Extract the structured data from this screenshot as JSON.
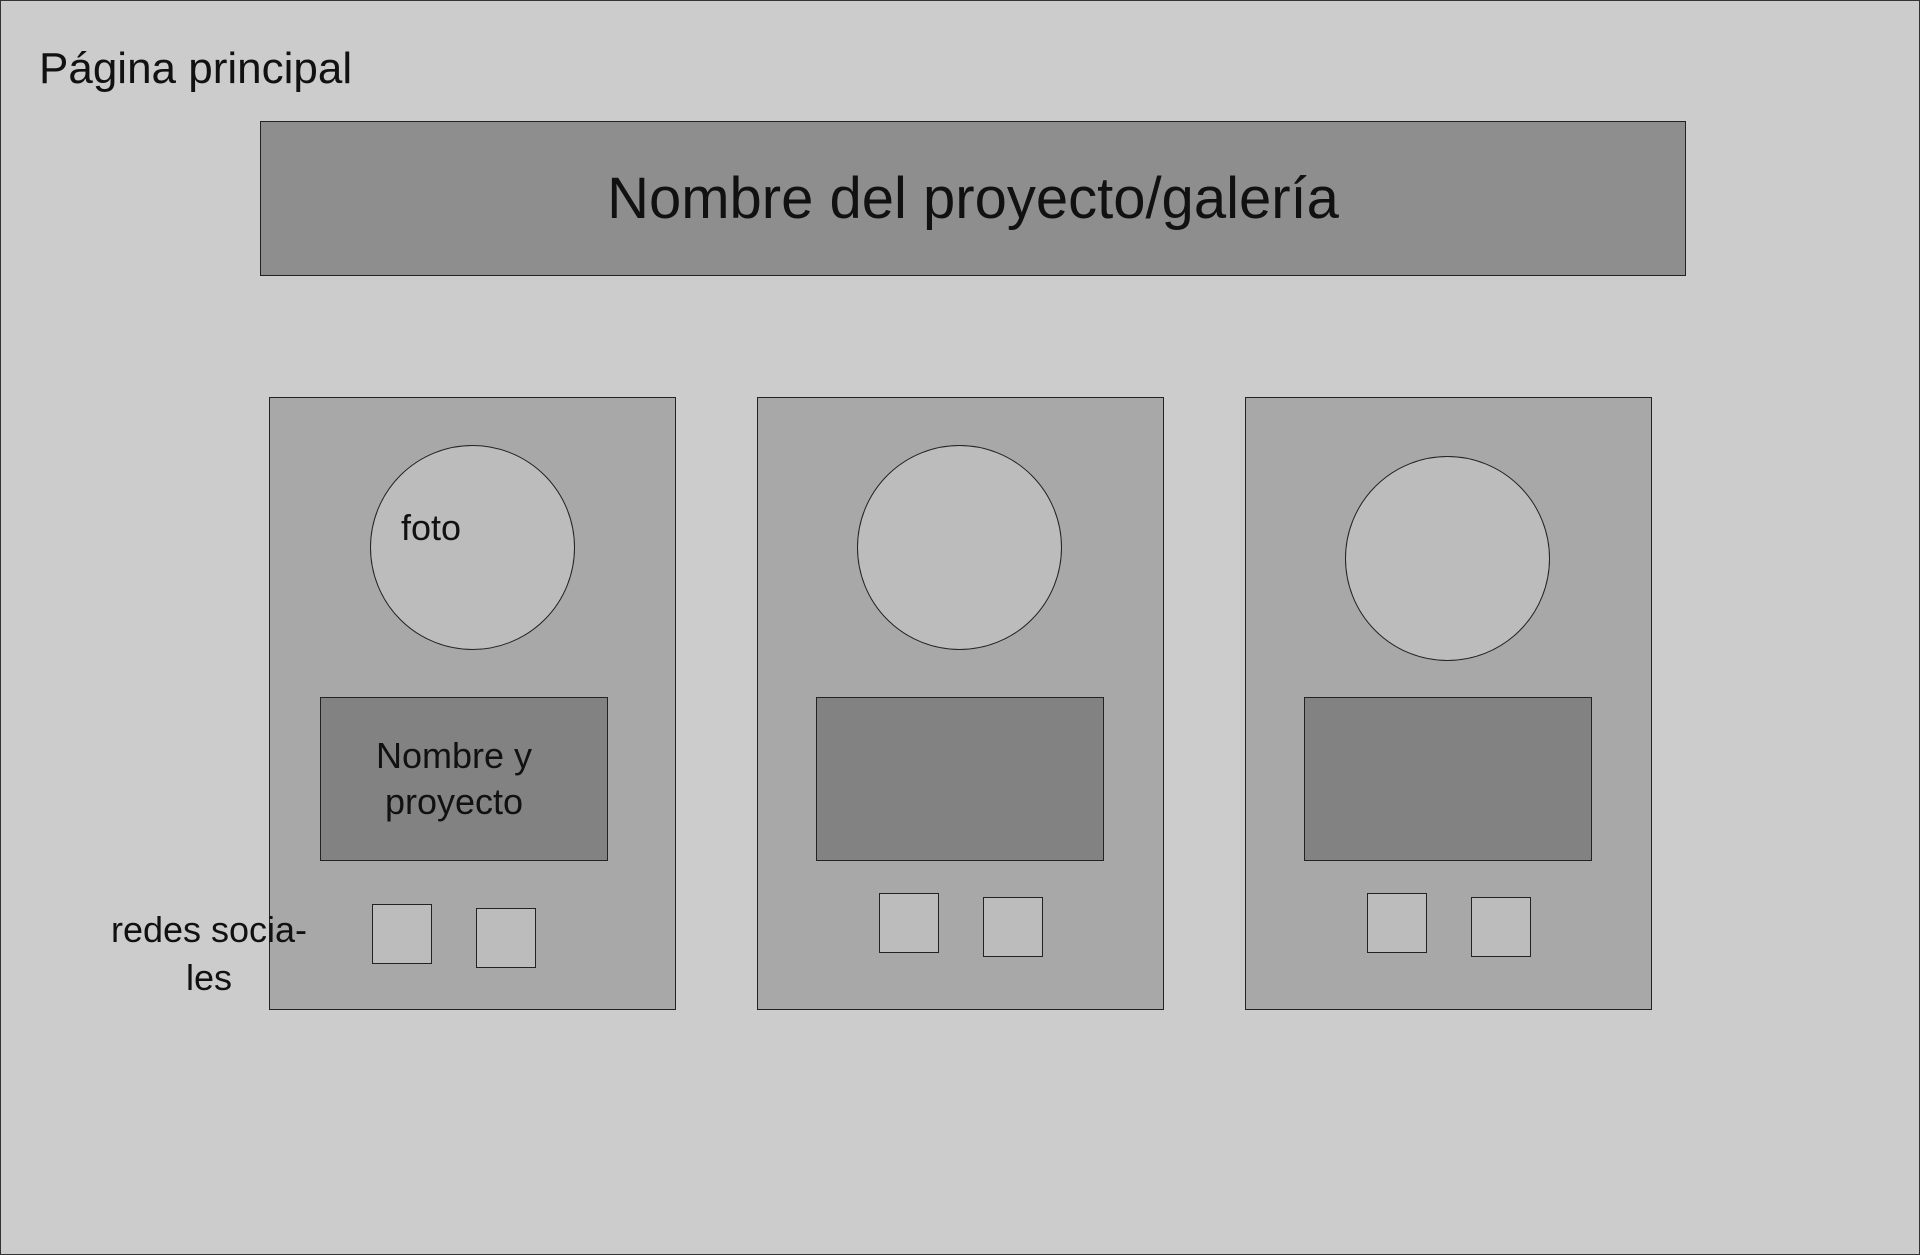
{
  "page": {
    "label": "Página principal"
  },
  "header": {
    "title": "Nombre del proyecto/galería"
  },
  "cards": [
    {
      "photo_label": "foto",
      "name_label": "Nombre y\nproyecto"
    },
    {
      "photo_label": "",
      "name_label": ""
    },
    {
      "photo_label": "",
      "name_label": ""
    }
  ],
  "annotations": {
    "social_label": "redes socia-\nles"
  },
  "colors": {
    "background": "#cccccc",
    "header": "#8e8e8e",
    "card": "#a8a8a8",
    "name_box": "#828282",
    "placeholder": "#bcbcbc",
    "stroke": "#222222"
  }
}
